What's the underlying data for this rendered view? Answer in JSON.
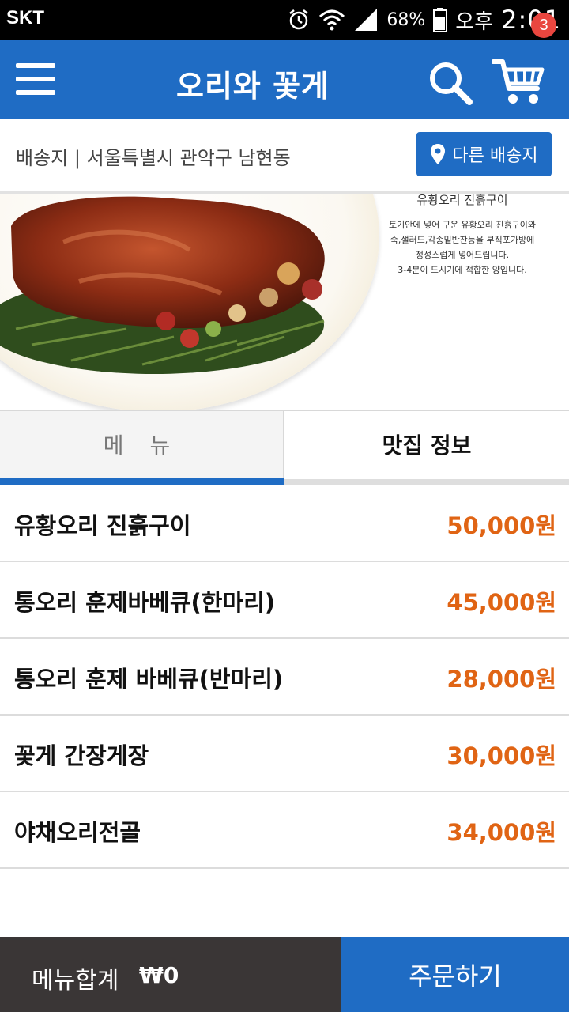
{
  "status_bar": {
    "carrier": "SKT",
    "battery": "68%",
    "ampm": "오후",
    "time": "2:01"
  },
  "app_bar": {
    "title": "오리와 꽃게",
    "cart_count": "3"
  },
  "delivery": {
    "address": "배송지 | 서울특별시 관악구 남현동",
    "change_button": "다른 배송지"
  },
  "banner": {
    "dish_title": "유황오리 진흙구이",
    "description": [
      "토기안에 넣어 구운 유황오리 진흙구이와",
      "죽,샐러드,각종밑반찬등을 부직포가방에",
      "정성스럽게 넣어드립니다.",
      "3-4분이 드시기에 적합한 양입니다."
    ]
  },
  "tabs": {
    "menu": "메 뉴",
    "info": "맛집 정보"
  },
  "menu": [
    {
      "name": "유황오리 진흙구이",
      "price": "50,000원"
    },
    {
      "name": "통오리 훈제바베큐(한마리)",
      "price": "45,000원"
    },
    {
      "name": "통오리 훈제 바베큐(반마리)",
      "price": "28,000원"
    },
    {
      "name": "꽃게 간장게장",
      "price": "30,000원"
    },
    {
      "name": "야채오리전골",
      "price": "34,000원"
    }
  ],
  "footer": {
    "total_label": "메뉴합계",
    "total_amount": "₩0",
    "order_button": "주문하기"
  },
  "colors": {
    "primary": "#1f6cc4",
    "price": "#e06414",
    "badge": "#e9463f",
    "footer_dark": "#3a3636"
  }
}
